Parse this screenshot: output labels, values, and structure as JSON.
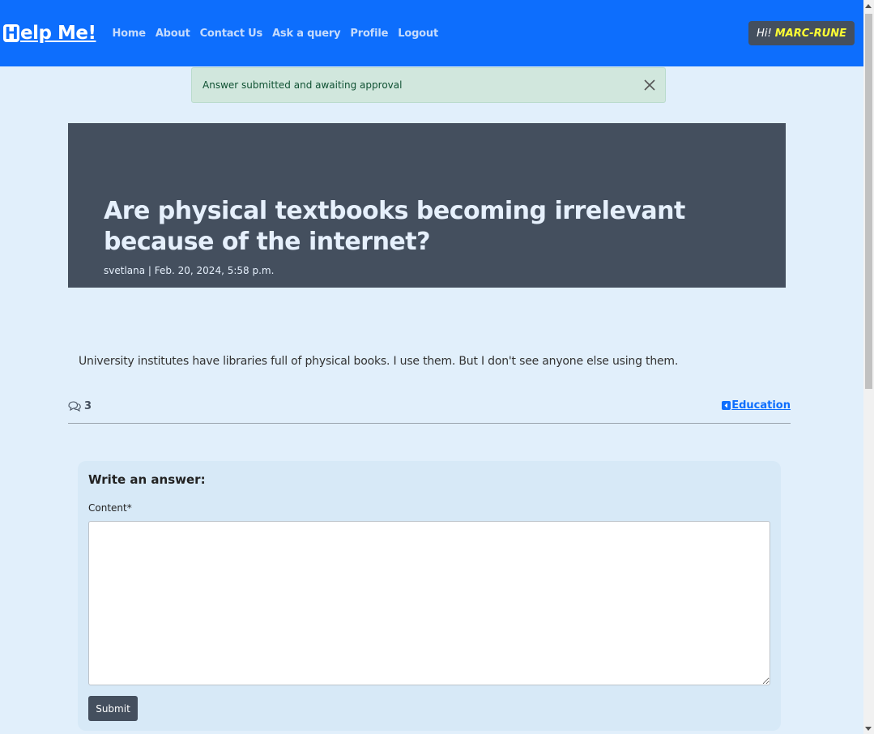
{
  "navbar": {
    "brand_initial": "H",
    "brand_rest": "elp Me!",
    "links": [
      "Home",
      "About",
      "Contact Us",
      "Ask a query",
      "Profile",
      "Logout"
    ],
    "greeting_prefix": "Hi!",
    "username": "MARC-RUNE"
  },
  "alert": {
    "message": "Answer submitted and awaiting approval"
  },
  "post": {
    "title": "Are physical textbooks becoming irrelevant because of the internet?",
    "meta": "svetlana | Feb. 20, 2024, 5:58 p.m.",
    "body": "University institutes have libraries full of physical books. I use them. But I don't see anyone else using them.",
    "comment_count": "3",
    "comment_icon": "chat-bubbles-icon",
    "category": "Education",
    "category_icon": "caret-left-square-icon"
  },
  "answer_form": {
    "heading": "Write an answer:",
    "content_label": "Content*",
    "content_value": "",
    "submit_label": "Submit"
  },
  "colors": {
    "navbar": "#0d6efd",
    "page_background": "#e1effb",
    "hero_background": "#444f5e",
    "alert_background": "#d1e7dd",
    "username": "#ffff33"
  }
}
